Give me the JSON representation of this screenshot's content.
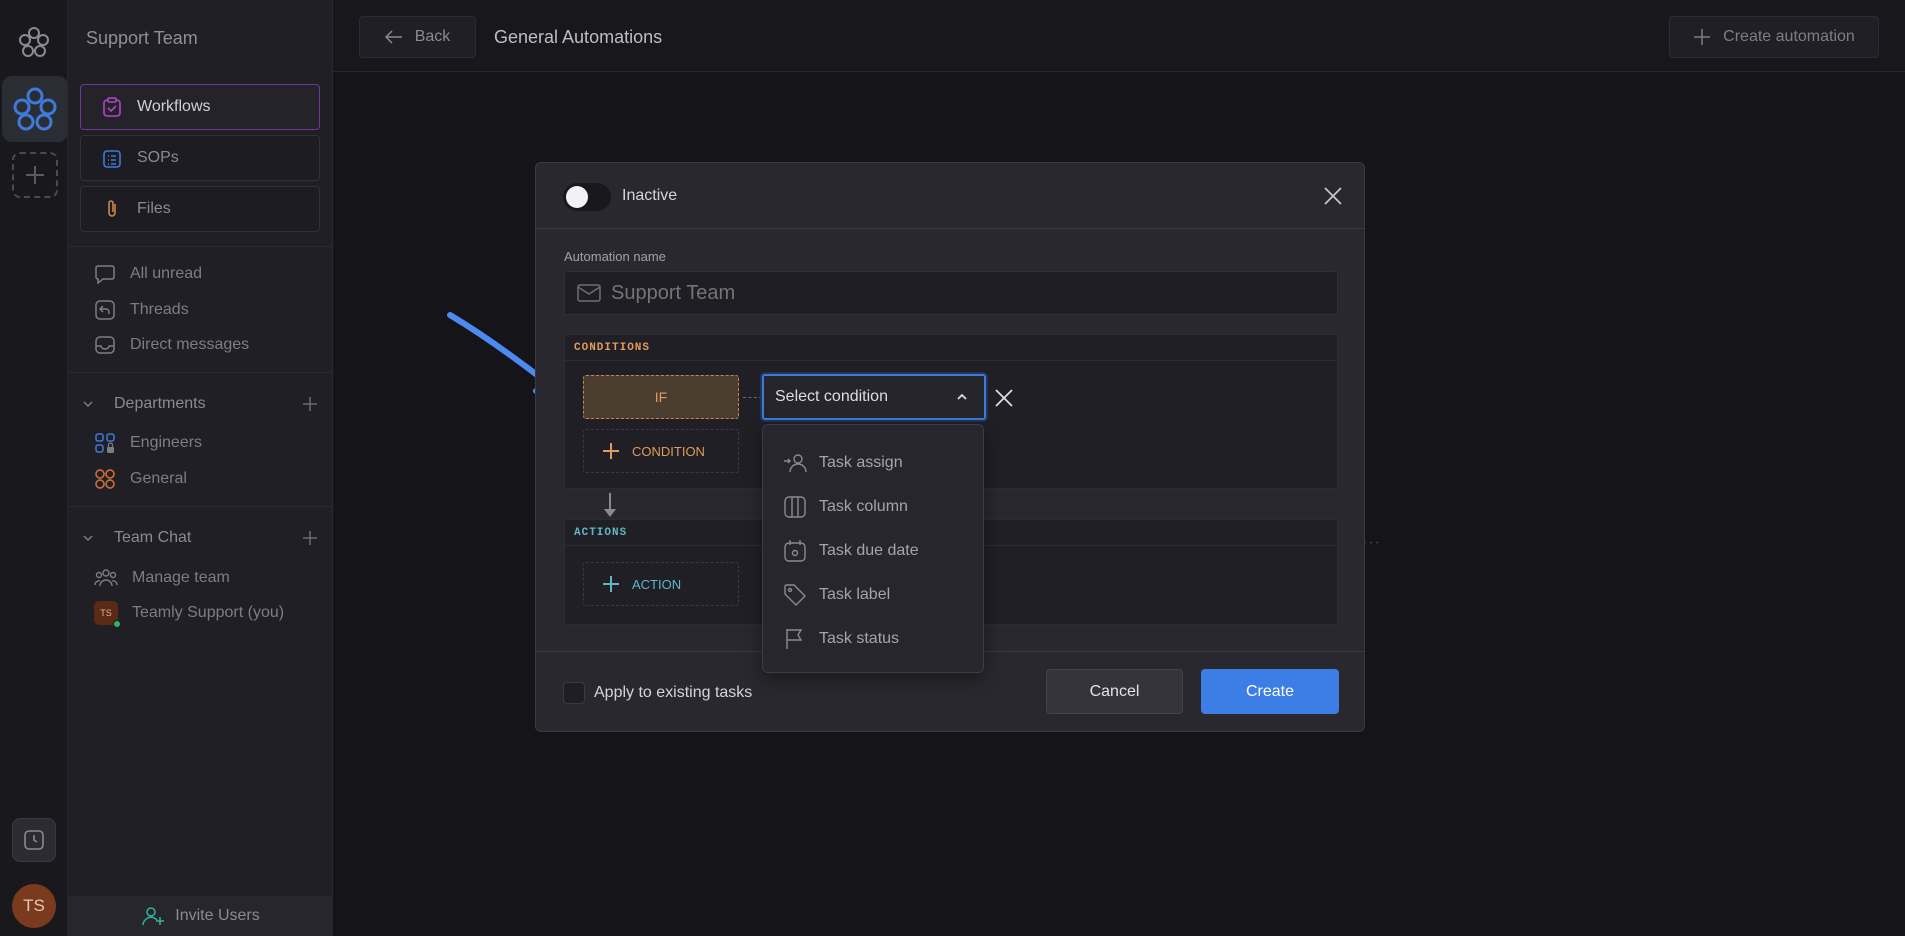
{
  "sidebar": {
    "workspace_title": "Support Team",
    "nav": [
      {
        "label": "Workflows",
        "icon": "clipboard-check-icon",
        "active": true
      },
      {
        "label": "SOPs",
        "icon": "list-clipboard-icon"
      },
      {
        "label": "Files",
        "icon": "paperclip-icon"
      }
    ],
    "inbox": [
      {
        "label": "All unread",
        "icon": "chat-bubble-icon"
      },
      {
        "label": "Threads",
        "icon": "reply-icon"
      },
      {
        "label": "Direct messages",
        "icon": "inbox-icon"
      }
    ],
    "departments": {
      "title": "Departments",
      "items": [
        {
          "label": "Engineers",
          "icon": "grid-lock-icon"
        },
        {
          "label": "General",
          "icon": "grid-circles-icon"
        }
      ]
    },
    "team_chat": {
      "title": "Team Chat",
      "items": [
        {
          "label": "Manage team",
          "icon": "people-icon"
        },
        {
          "label": "Teamly Support (you)",
          "avatar": "TS"
        }
      ]
    },
    "invite_label": "Invite Users"
  },
  "rail": {
    "avatar": "TS"
  },
  "topbar": {
    "back_label": "Back",
    "title": "General Automations",
    "create_label": "Create automation"
  },
  "modal": {
    "status_label": "Inactive",
    "name_label": "Automation name",
    "name_placeholder": "Support Team",
    "conditions_label": "CONDITIONS",
    "if_label": "IF",
    "add_condition_label": "CONDITION",
    "select_placeholder": "Select condition",
    "actions_label": "ACTIONS",
    "add_action_label": "ACTION",
    "apply_existing_label": "Apply to existing tasks",
    "cancel_label": "Cancel",
    "create_label": "Create"
  },
  "condition_options": [
    {
      "label": "Task assign",
      "icon": "person-arrow-icon"
    },
    {
      "label": "Task column",
      "icon": "columns-icon"
    },
    {
      "label": "Task due date",
      "icon": "calendar-icon"
    },
    {
      "label": "Task label",
      "icon": "tag-icon"
    },
    {
      "label": "Task status",
      "icon": "flag-icon"
    }
  ],
  "colors": {
    "accent_blue": "#3d7ee6",
    "condition_orange": "#e29a5a",
    "action_teal": "#5fb8c4",
    "active_border": "#6a3a9a"
  }
}
